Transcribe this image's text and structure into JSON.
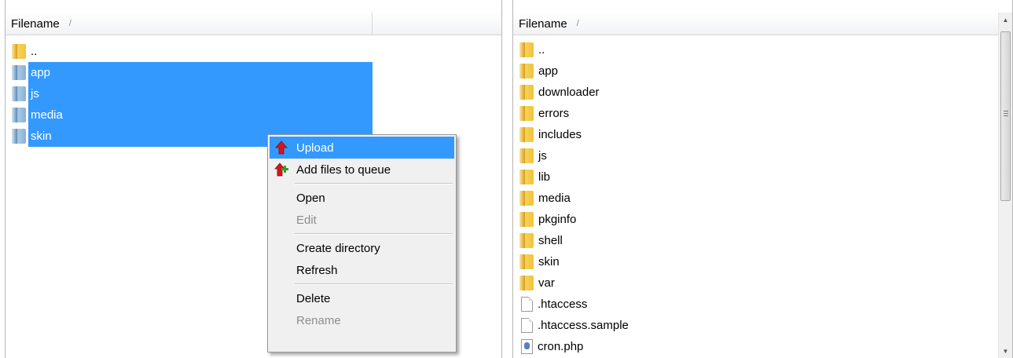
{
  "local": {
    "column_header": "Filename",
    "sort_indicator": "/",
    "items": [
      {
        "name": "..",
        "type": "folder",
        "selected": false
      },
      {
        "name": "app",
        "type": "folder",
        "selected": true
      },
      {
        "name": "js",
        "type": "folder",
        "selected": true
      },
      {
        "name": "media",
        "type": "folder",
        "selected": true
      },
      {
        "name": "skin",
        "type": "folder",
        "selected": true
      }
    ]
  },
  "remote": {
    "column_header": "Filename",
    "sort_indicator": "/",
    "items": [
      {
        "name": "..",
        "type": "folder"
      },
      {
        "name": "app",
        "type": "folder"
      },
      {
        "name": "downloader",
        "type": "folder"
      },
      {
        "name": "errors",
        "type": "folder"
      },
      {
        "name": "includes",
        "type": "folder"
      },
      {
        "name": "js",
        "type": "folder"
      },
      {
        "name": "lib",
        "type": "folder"
      },
      {
        "name": "media",
        "type": "folder"
      },
      {
        "name": "pkginfo",
        "type": "folder"
      },
      {
        "name": "shell",
        "type": "folder"
      },
      {
        "name": "skin",
        "type": "folder"
      },
      {
        "name": "var",
        "type": "folder"
      },
      {
        "name": ".htaccess",
        "type": "file"
      },
      {
        "name": ".htaccess.sample",
        "type": "file"
      },
      {
        "name": "cron.php",
        "type": "php"
      }
    ]
  },
  "context_menu": {
    "upload": "Upload",
    "add_to_queue": "Add files to queue",
    "open": "Open",
    "edit": "Edit",
    "create_directory": "Create directory",
    "refresh": "Refresh",
    "delete": "Delete",
    "rename": "Rename"
  },
  "icons": {
    "upload": "upload-arrow-icon",
    "add_to_queue": "add-queue-icon",
    "folder": "folder-icon",
    "file": "file-icon",
    "php": "php-file-icon"
  },
  "colors": {
    "selection": "#3399ff",
    "disabled_text": "#8d8d8d",
    "menu_bg": "#f0f0f0"
  }
}
